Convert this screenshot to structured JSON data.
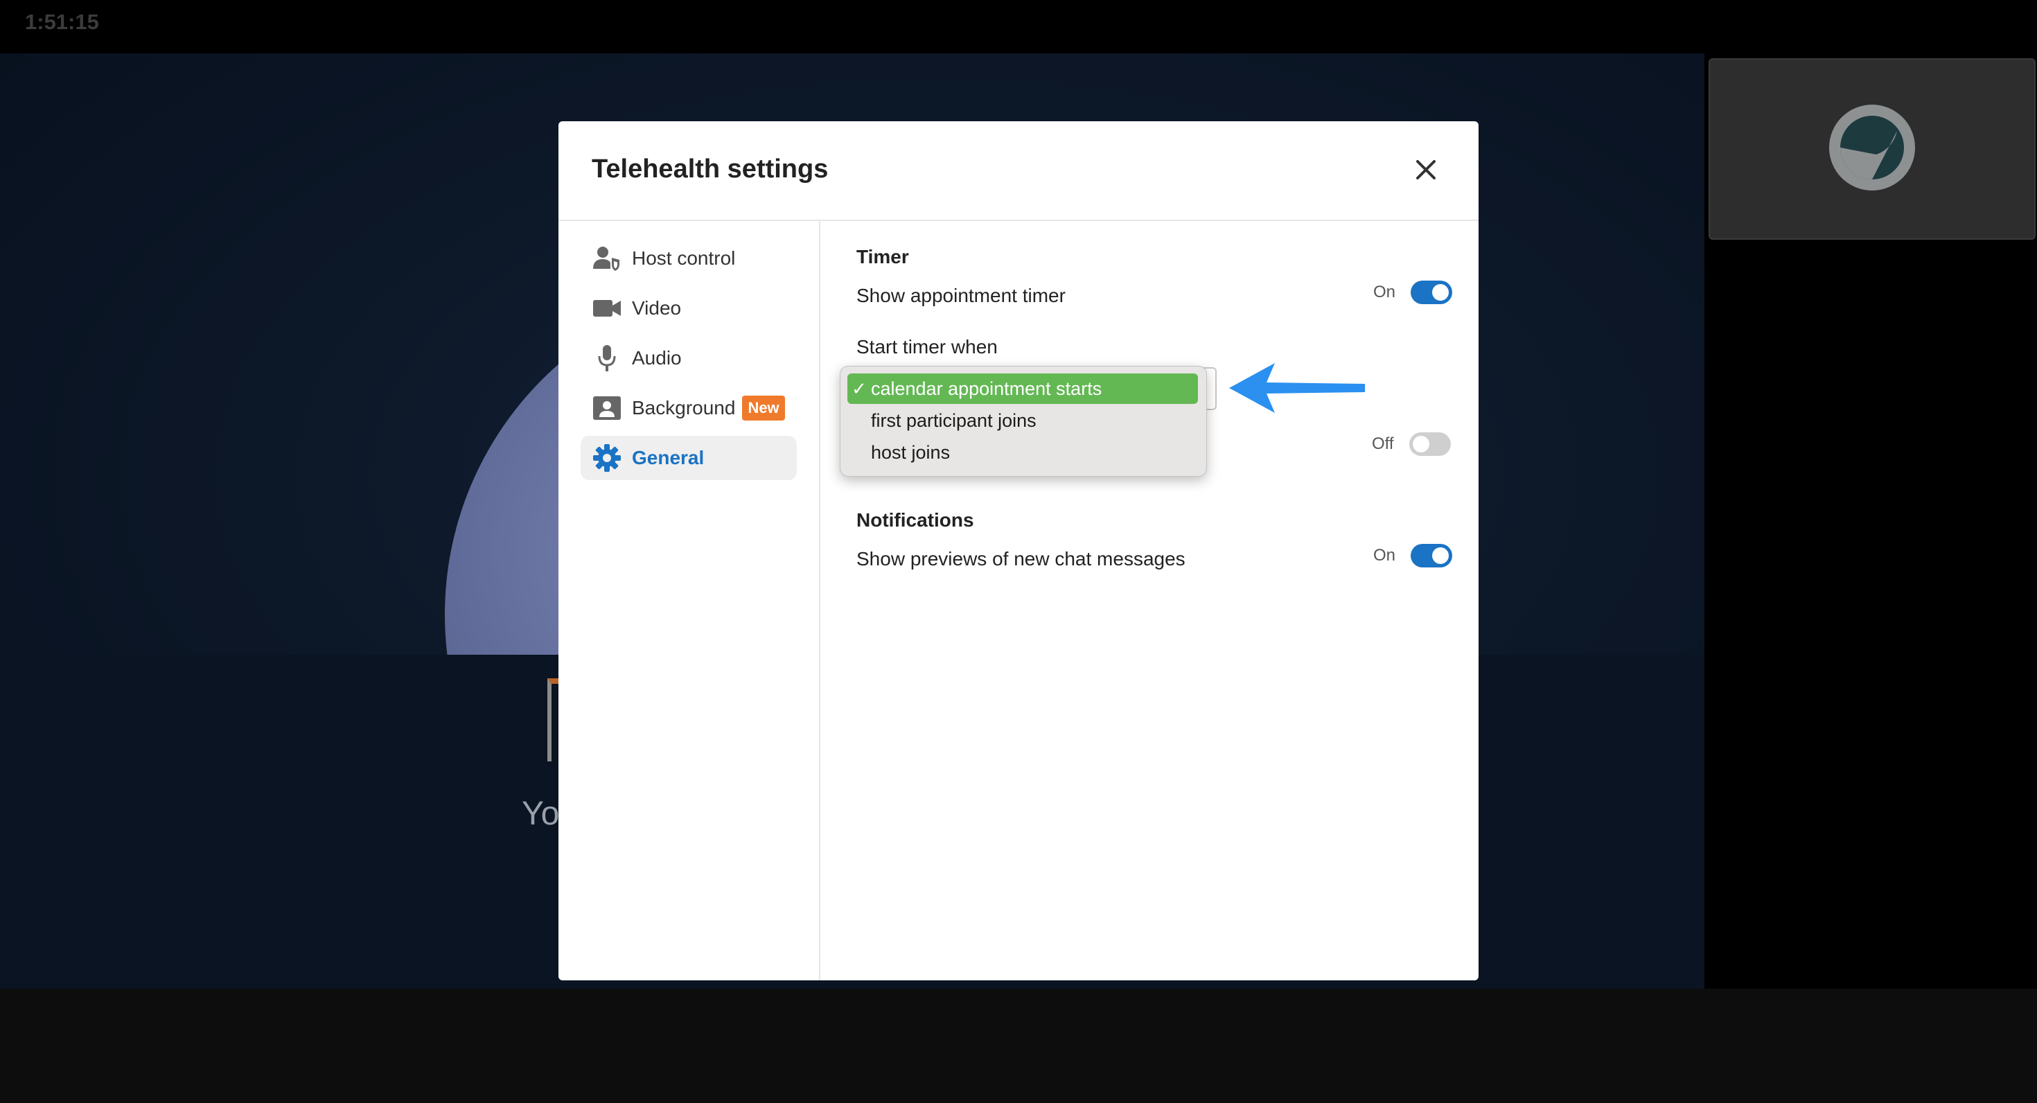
{
  "session": {
    "elapsed_time": "1:51:15",
    "self_view_caption_partial": "Yo"
  },
  "modal": {
    "title": "Telehealth settings",
    "close_icon": "close-icon"
  },
  "sidebar": {
    "items": [
      {
        "label": "Host control",
        "icon": "host-control-icon",
        "active": false
      },
      {
        "label": "Video",
        "icon": "video-camera-icon",
        "active": false
      },
      {
        "label": "Audio",
        "icon": "microphone-icon",
        "active": false
      },
      {
        "label": "Background",
        "icon": "background-portrait-icon",
        "badge": "New",
        "active": false
      },
      {
        "label": "General",
        "icon": "gear-icon",
        "active": true
      }
    ]
  },
  "general": {
    "timer_section": {
      "title": "Timer",
      "show_timer_label": "Show appointment timer",
      "show_timer_state": "On",
      "start_timer_label": "Start timer when",
      "start_timer_options": [
        "calendar appointment starts",
        "first participant joins",
        "host joins"
      ],
      "start_timer_selected": "calendar appointment starts",
      "hidden_row_state": "Off"
    },
    "notifications_section": {
      "title": "Notifications",
      "chat_preview_label": "Show previews of new chat messages",
      "chat_preview_state": "On"
    }
  },
  "colors": {
    "accent": "#1a73c4",
    "badge": "#f07a2b",
    "dropdown_selected": "#64b854",
    "annotation_arrow": "#2b90f0"
  }
}
